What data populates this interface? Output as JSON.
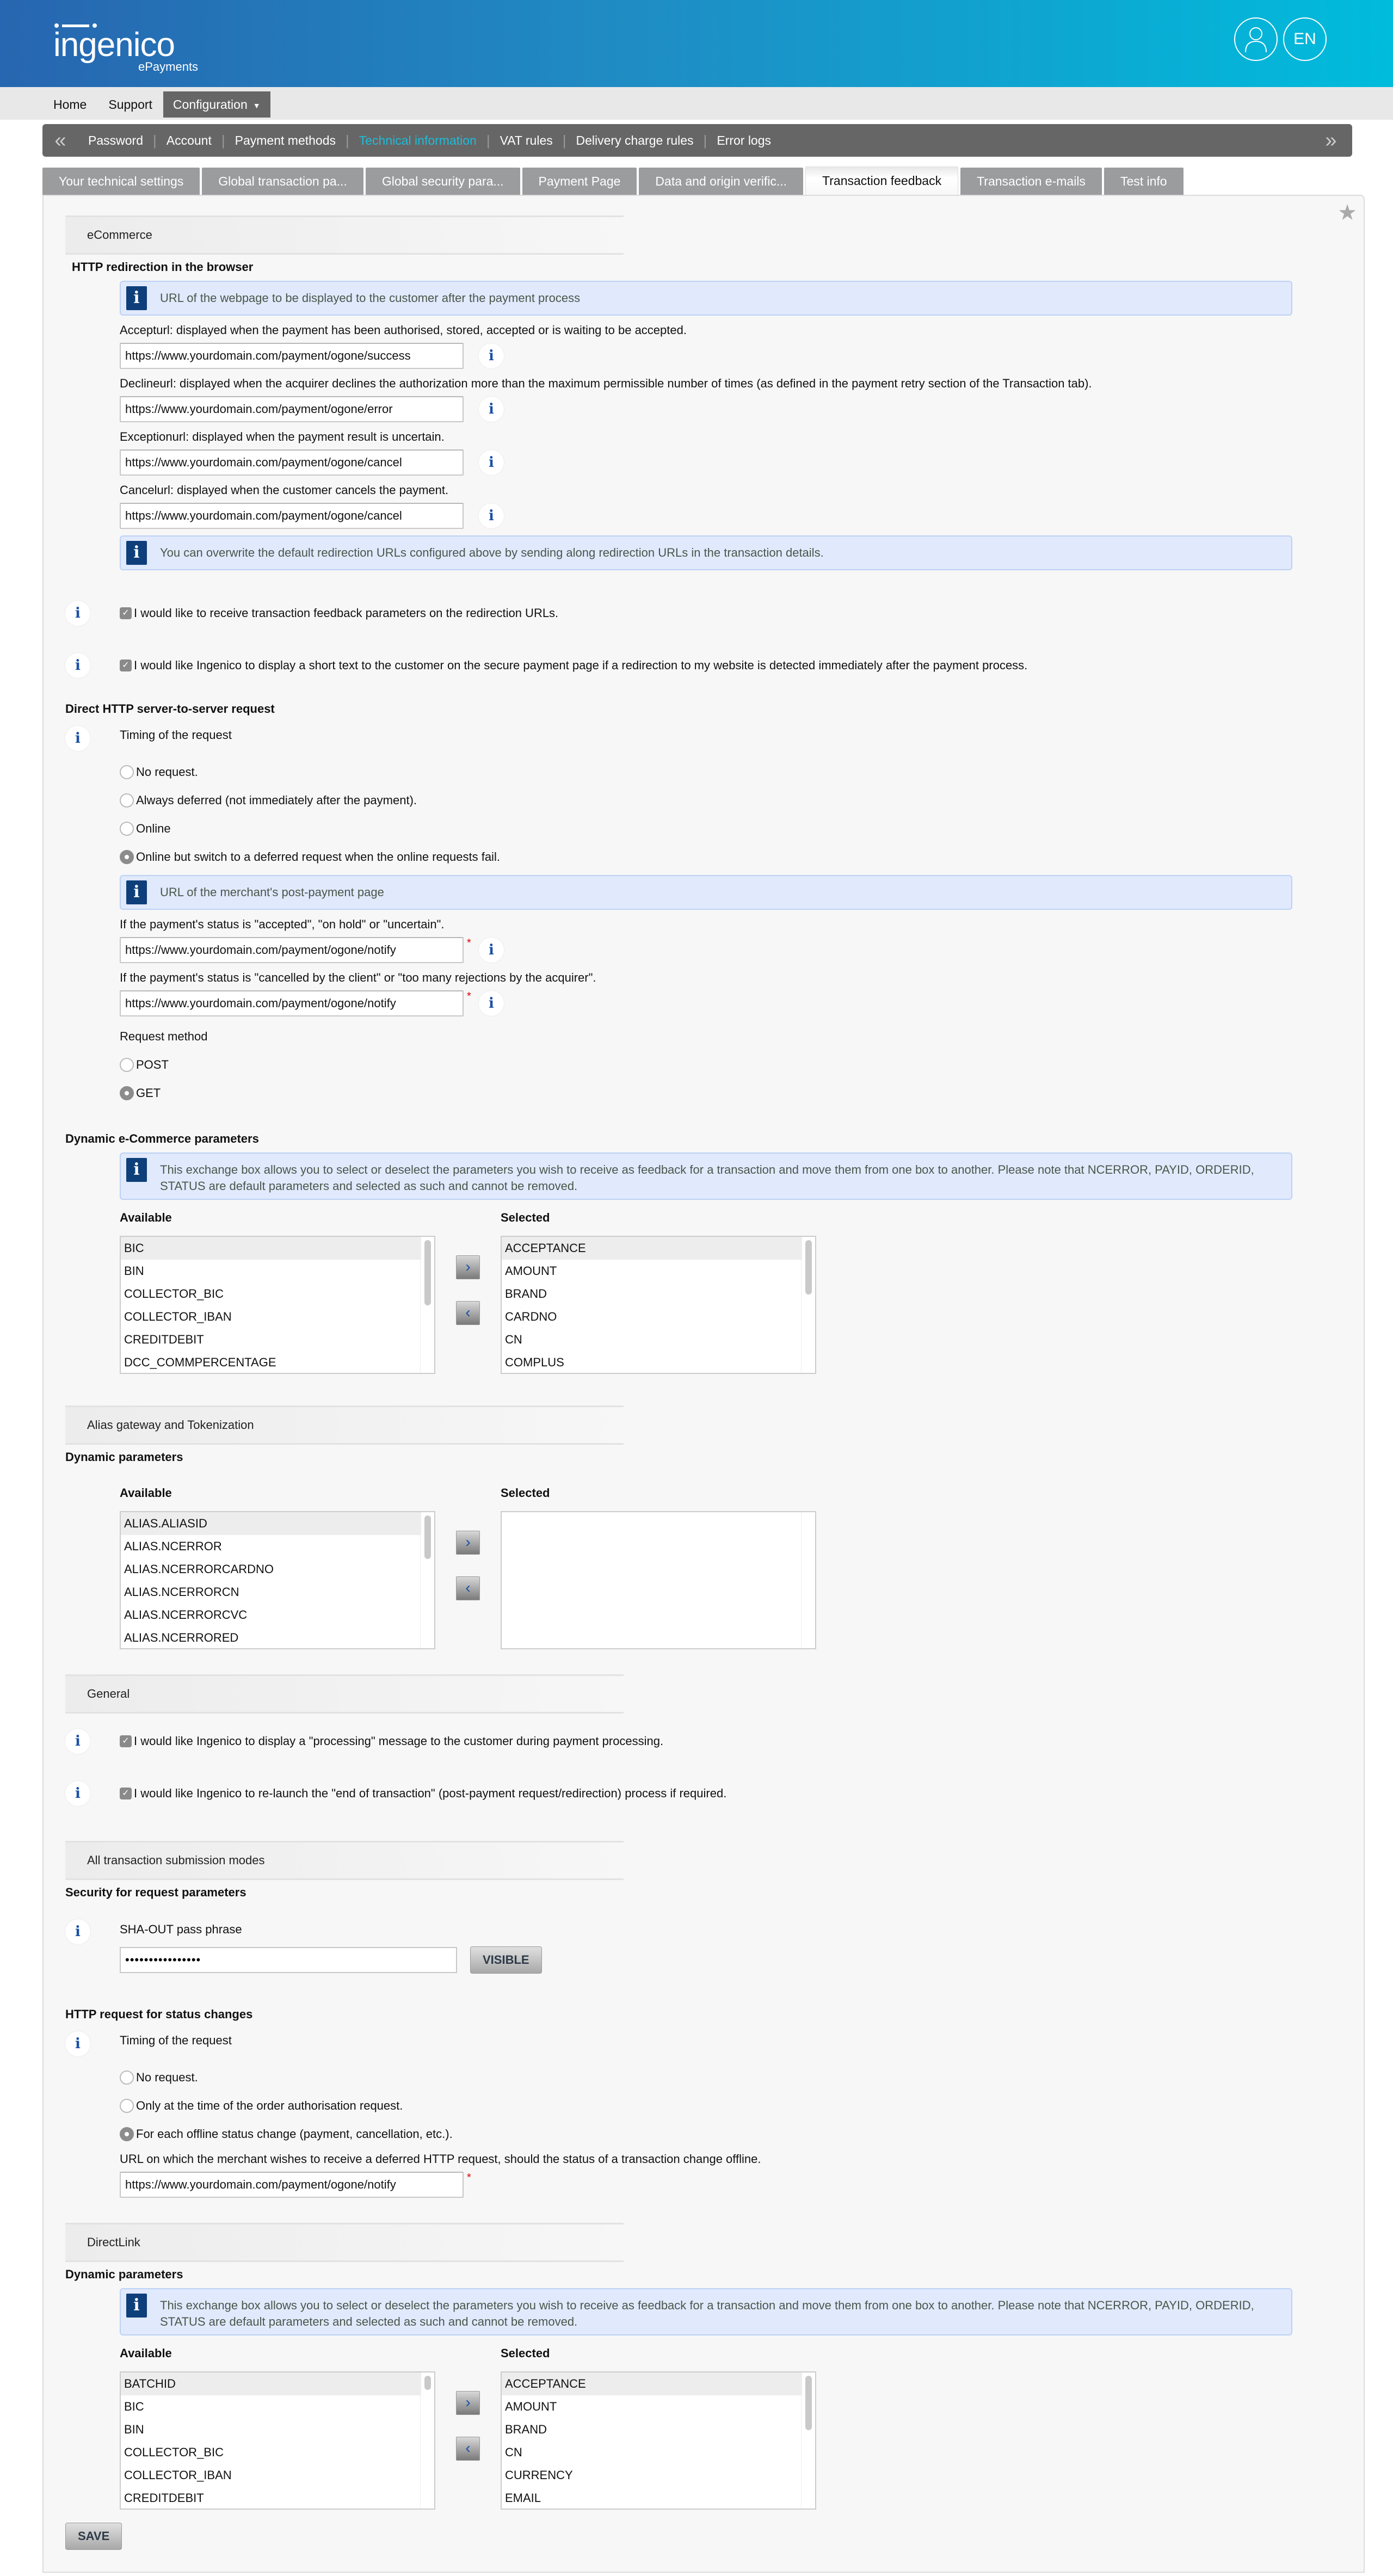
{
  "header": {
    "logo_word": "ingenico",
    "logo_sub": "ePayments",
    "user_icon": "user-icon",
    "language": "EN"
  },
  "topnav": {
    "items": [
      "Home",
      "Support",
      "Configuration"
    ],
    "active": "Configuration"
  },
  "subnav": {
    "items": [
      "Password",
      "Account",
      "Payment methods",
      "Technical information",
      "VAT rules",
      "Delivery charge rules",
      "Error logs"
    ],
    "active": "Technical information"
  },
  "tabs": {
    "items": [
      "Your technical settings",
      "Global transaction pa...",
      "Global security para...",
      "Payment Page",
      "Data and origin verific...",
      "Transaction feedback",
      "Transaction e-mails",
      "Test info"
    ],
    "active": "Transaction feedback"
  },
  "ecommerce": {
    "section_title": "eCommerce",
    "redirection": {
      "heading": "HTTP redirection in the browser",
      "info": "URL of the webpage to be displayed to the customer after the payment process",
      "fields": [
        {
          "label": "Accepturl: displayed when the payment has been authorised, stored, accepted or is waiting to be accepted.",
          "value": "https://www.yourdomain.com/payment/ogone/success"
        },
        {
          "label": "Declineurl: displayed when the acquirer declines the authorization more than the maximum permissible number of times (as defined in the payment retry section of the Transaction tab).",
          "value": "https://www.yourdomain.com/payment/ogone/error"
        },
        {
          "label": "Exceptionurl: displayed when the payment result is uncertain.",
          "value": "https://www.yourdomain.com/payment/ogone/cancel"
        },
        {
          "label": "Cancelurl: displayed when the customer cancels the payment.",
          "value": "https://www.yourdomain.com/payment/ogone/cancel"
        }
      ],
      "overwrite_info": "You can overwrite the default redirection URLs configured above by sending along redirection URLs in the transaction details.",
      "checkboxes": [
        {
          "label": "I would like to receive transaction feedback parameters on the redirection URLs.",
          "checked": true
        },
        {
          "label": "I would like Ingenico to display a short text to the customer on the secure payment page if a redirection to my website is detected immediately after the payment process.",
          "checked": true
        }
      ]
    },
    "direct": {
      "heading": "Direct HTTP server-to-server request",
      "timing_label": "Timing of the request",
      "options": [
        "No request.",
        "Always deferred (not immediately after the payment).",
        "Online",
        "Online but switch to a deferred request when the online requests fail."
      ],
      "selected": 3,
      "info": "URL of the merchant's post-payment page",
      "url_fields": [
        {
          "label": "If the payment's status is \"accepted\", \"on hold\" or \"uncertain\".",
          "value": "https://www.yourdomain.com/payment/ogone/notify",
          "required": true
        },
        {
          "label": "If the payment's status is \"cancelled by the client\" or \"too many rejections by the acquirer\".",
          "value": "https://www.yourdomain.com/payment/ogone/notify",
          "required": true
        }
      ],
      "method_label": "Request method",
      "methods": [
        "POST",
        "GET"
      ],
      "method_selected": 1
    },
    "dynamic": {
      "heading": "Dynamic e-Commerce parameters",
      "info": "This exchange box allows you to select or deselect the parameters you wish to receive as feedback for a transaction and move them from one box to another. Please note that NCERROR, PAYID, ORDERID, STATUS are default parameters and selected as such and cannot be removed.",
      "available_label": "Available",
      "selected_label": "Selected",
      "available": [
        "BIC",
        "BIN",
        "COLLECTOR_BIC",
        "COLLECTOR_IBAN",
        "CREDITDEBIT",
        "DCC_COMMPERCENTAGE"
      ],
      "selected": [
        "ACCEPTANCE",
        "AMOUNT",
        "BRAND",
        "CARDNO",
        "CN",
        "COMPLUS"
      ]
    }
  },
  "alias": {
    "section_title": "Alias gateway and Tokenization",
    "heading": "Dynamic parameters",
    "available_label": "Available",
    "selected_label": "Selected",
    "available": [
      "ALIAS.ALIASID",
      "ALIAS.NCERROR",
      "ALIAS.NCERRORCARDNO",
      "ALIAS.NCERRORCN",
      "ALIAS.NCERRORCVC",
      "ALIAS.NCERRORED"
    ],
    "selected": []
  },
  "general": {
    "section_title": "General",
    "checkboxes": [
      {
        "label": "I would like Ingenico to display a \"processing\" message to the customer during payment processing.",
        "checked": true
      },
      {
        "label": "I would like Ingenico to re-launch the \"end of transaction\" (post-payment request/redirection) process if required.",
        "checked": true
      }
    ]
  },
  "all_modes": {
    "section_title": "All transaction submission modes",
    "security_heading": "Security for request parameters",
    "sha_label": "SHA-OUT pass phrase",
    "sha_value": "••••••••••••••••",
    "visible_button": "VISIBLE",
    "status_heading": "HTTP request for status changes",
    "timing_label": "Timing of the request",
    "options": [
      "No request.",
      "Only at the time of the order authorisation request.",
      "For each offline status change (payment, cancellation, etc.)."
    ],
    "selected": 2,
    "url_label": "URL on which the merchant wishes to receive a deferred HTTP request, should the status of a transaction change offline.",
    "url_value": "https://www.yourdomain.com/payment/ogone/notify"
  },
  "directlink": {
    "section_title": "DirectLink",
    "heading": "Dynamic parameters",
    "info": "This exchange box allows you to select or deselect the parameters you wish to receive as feedback for a transaction and move them from one box to another. Please note that NCERROR, PAYID, ORDERID, STATUS are default parameters and selected as such and cannot be removed.",
    "available_label": "Available",
    "selected_label": "Selected",
    "available": [
      "BATCHID",
      "BIC",
      "BIN",
      "COLLECTOR_BIC",
      "COLLECTOR_IBAN",
      "CREDITDEBIT"
    ],
    "selected": [
      "ACCEPTANCE",
      "AMOUNT",
      "BRAND",
      "CN",
      "CURRENCY",
      "EMAIL"
    ]
  },
  "save_label": "SAVE",
  "icons": {
    "info_glyph": "i",
    "arrow_right": "›",
    "arrow_left": "‹",
    "chev_left": "«",
    "chev_right": "»",
    "star": "★",
    "check": "✓",
    "caret": "▼"
  }
}
